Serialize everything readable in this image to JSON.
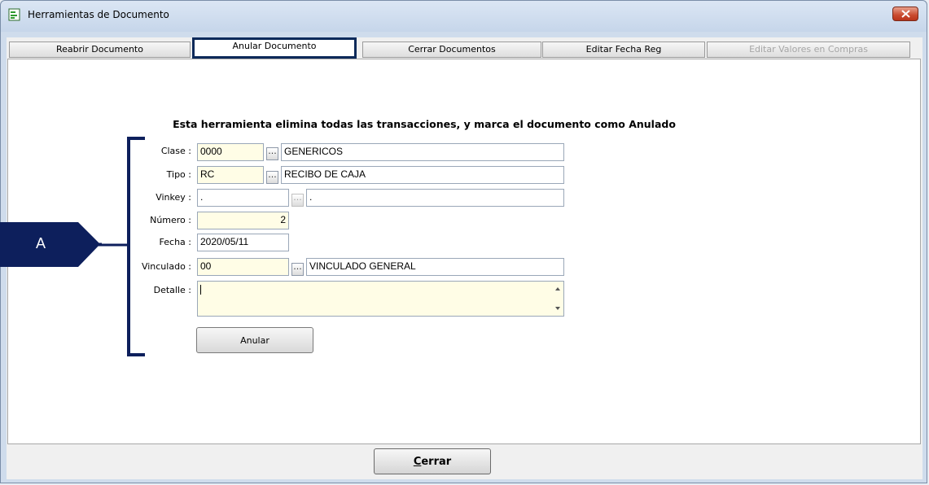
{
  "window": {
    "title": "Herramientas de Documento"
  },
  "tabs": [
    {
      "label": "Reabrir Documento",
      "state": "normal"
    },
    {
      "label": "Anular Documento",
      "state": "active"
    },
    {
      "label": "Cerrar Documentos",
      "state": "normal"
    },
    {
      "label": "Editar Fecha Reg",
      "state": "normal"
    },
    {
      "label": "Editar Valores en Compras",
      "state": "disabled"
    }
  ],
  "panel": {
    "heading": "Esta herramienta elimina todas las transacciones, y marca el documento como Anulado"
  },
  "form": {
    "clase": {
      "label": "Clase :",
      "code": "0000",
      "desc": "GENERICOS"
    },
    "tipo": {
      "label": "Tipo :",
      "code": "RC",
      "desc": "RECIBO DE CAJA"
    },
    "vinkey": {
      "label": "Vinkey :",
      "code": ".",
      "desc": "."
    },
    "numero": {
      "label": "Número :",
      "value": "2"
    },
    "fecha": {
      "label": "Fecha :",
      "value": "2020/05/11"
    },
    "vinculado": {
      "label": "Vinculado :",
      "code": "00",
      "desc": "VINCULADO GENERAL"
    },
    "detalle": {
      "label": "Detalle :",
      "value": ""
    },
    "ellipsis_label": "...",
    "anular_label": "Anular"
  },
  "footer": {
    "cerrar_first": "C",
    "cerrar_rest": "errar"
  },
  "annotation": {
    "callout_label": "A",
    "color": "#0d1f5c"
  },
  "icons": {
    "app": "document-tools-icon",
    "close": "close-icon"
  }
}
